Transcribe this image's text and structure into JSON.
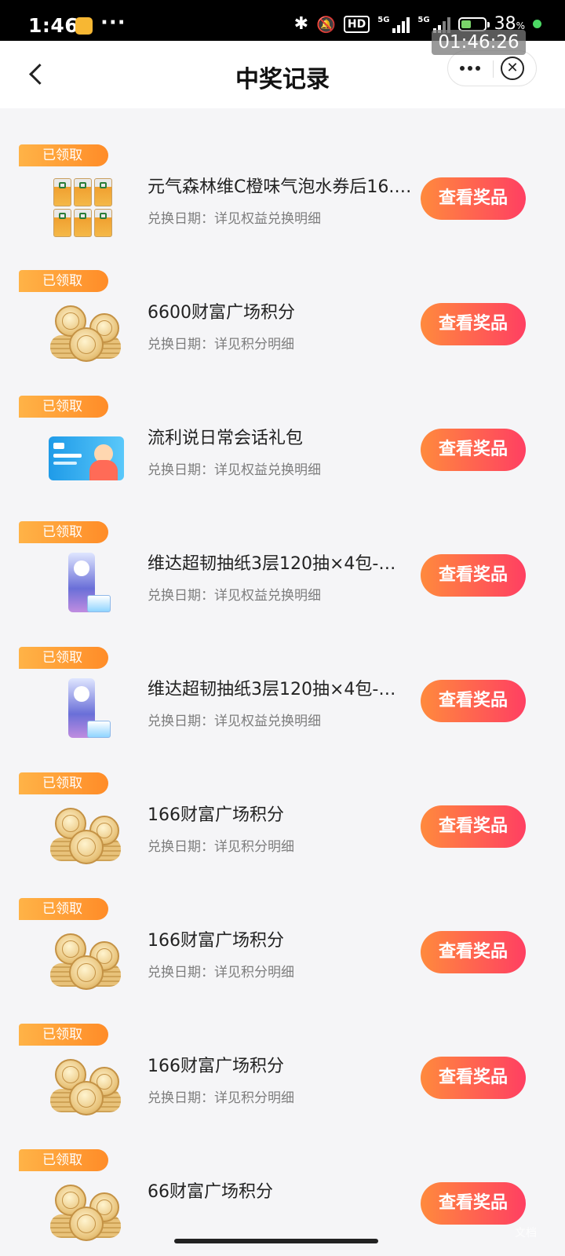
{
  "status_bar": {
    "time": "1:46",
    "dots": "···",
    "hd_label": "HD",
    "network_1": "5G",
    "network_2": "5G",
    "battery_percent": "38",
    "battery_unit": "%",
    "overlay_clock": "01:46:26"
  },
  "nav": {
    "title": "中奖记录"
  },
  "records": [
    {
      "status": "已领取",
      "title": "元气森林维C橙味气泡水券后16.…",
      "subtitle": "兑换日期：详见权益兑换明细",
      "button": "查看奖品",
      "image": "drink-cans"
    },
    {
      "status": "已领取",
      "title": "6600财富广场积分",
      "subtitle": "兑换日期：详见积分明细",
      "button": "查看奖品",
      "image": "coins"
    },
    {
      "status": "已领取",
      "title": "流利说日常会话礼包",
      "subtitle": "兑换日期：详见权益兑换明细",
      "button": "查看奖品",
      "image": "course-card"
    },
    {
      "status": "已领取",
      "title": "维达超韧抽纸3层120抽×4包-…",
      "subtitle": "兑换日期：详见权益兑换明细",
      "button": "查看奖品",
      "image": "tissue-pack"
    },
    {
      "status": "已领取",
      "title": "维达超韧抽纸3层120抽×4包-…",
      "subtitle": "兑换日期：详见权益兑换明细",
      "button": "查看奖品",
      "image": "tissue-pack"
    },
    {
      "status": "已领取",
      "title": "166财富广场积分",
      "subtitle": "兑换日期：详见积分明细",
      "button": "查看奖品",
      "image": "coins"
    },
    {
      "status": "已领取",
      "title": "166财富广场积分",
      "subtitle": "兑换日期：详见积分明细",
      "button": "查看奖品",
      "image": "coins"
    },
    {
      "status": "已领取",
      "title": "166财富广场积分",
      "subtitle": "兑换日期：详见积分明细",
      "button": "查看奖品",
      "image": "coins"
    },
    {
      "status": "已领取",
      "title": "66财富广场积分",
      "subtitle": "",
      "button": "查看奖品",
      "image": "coins"
    }
  ],
  "watermark": "文档"
}
